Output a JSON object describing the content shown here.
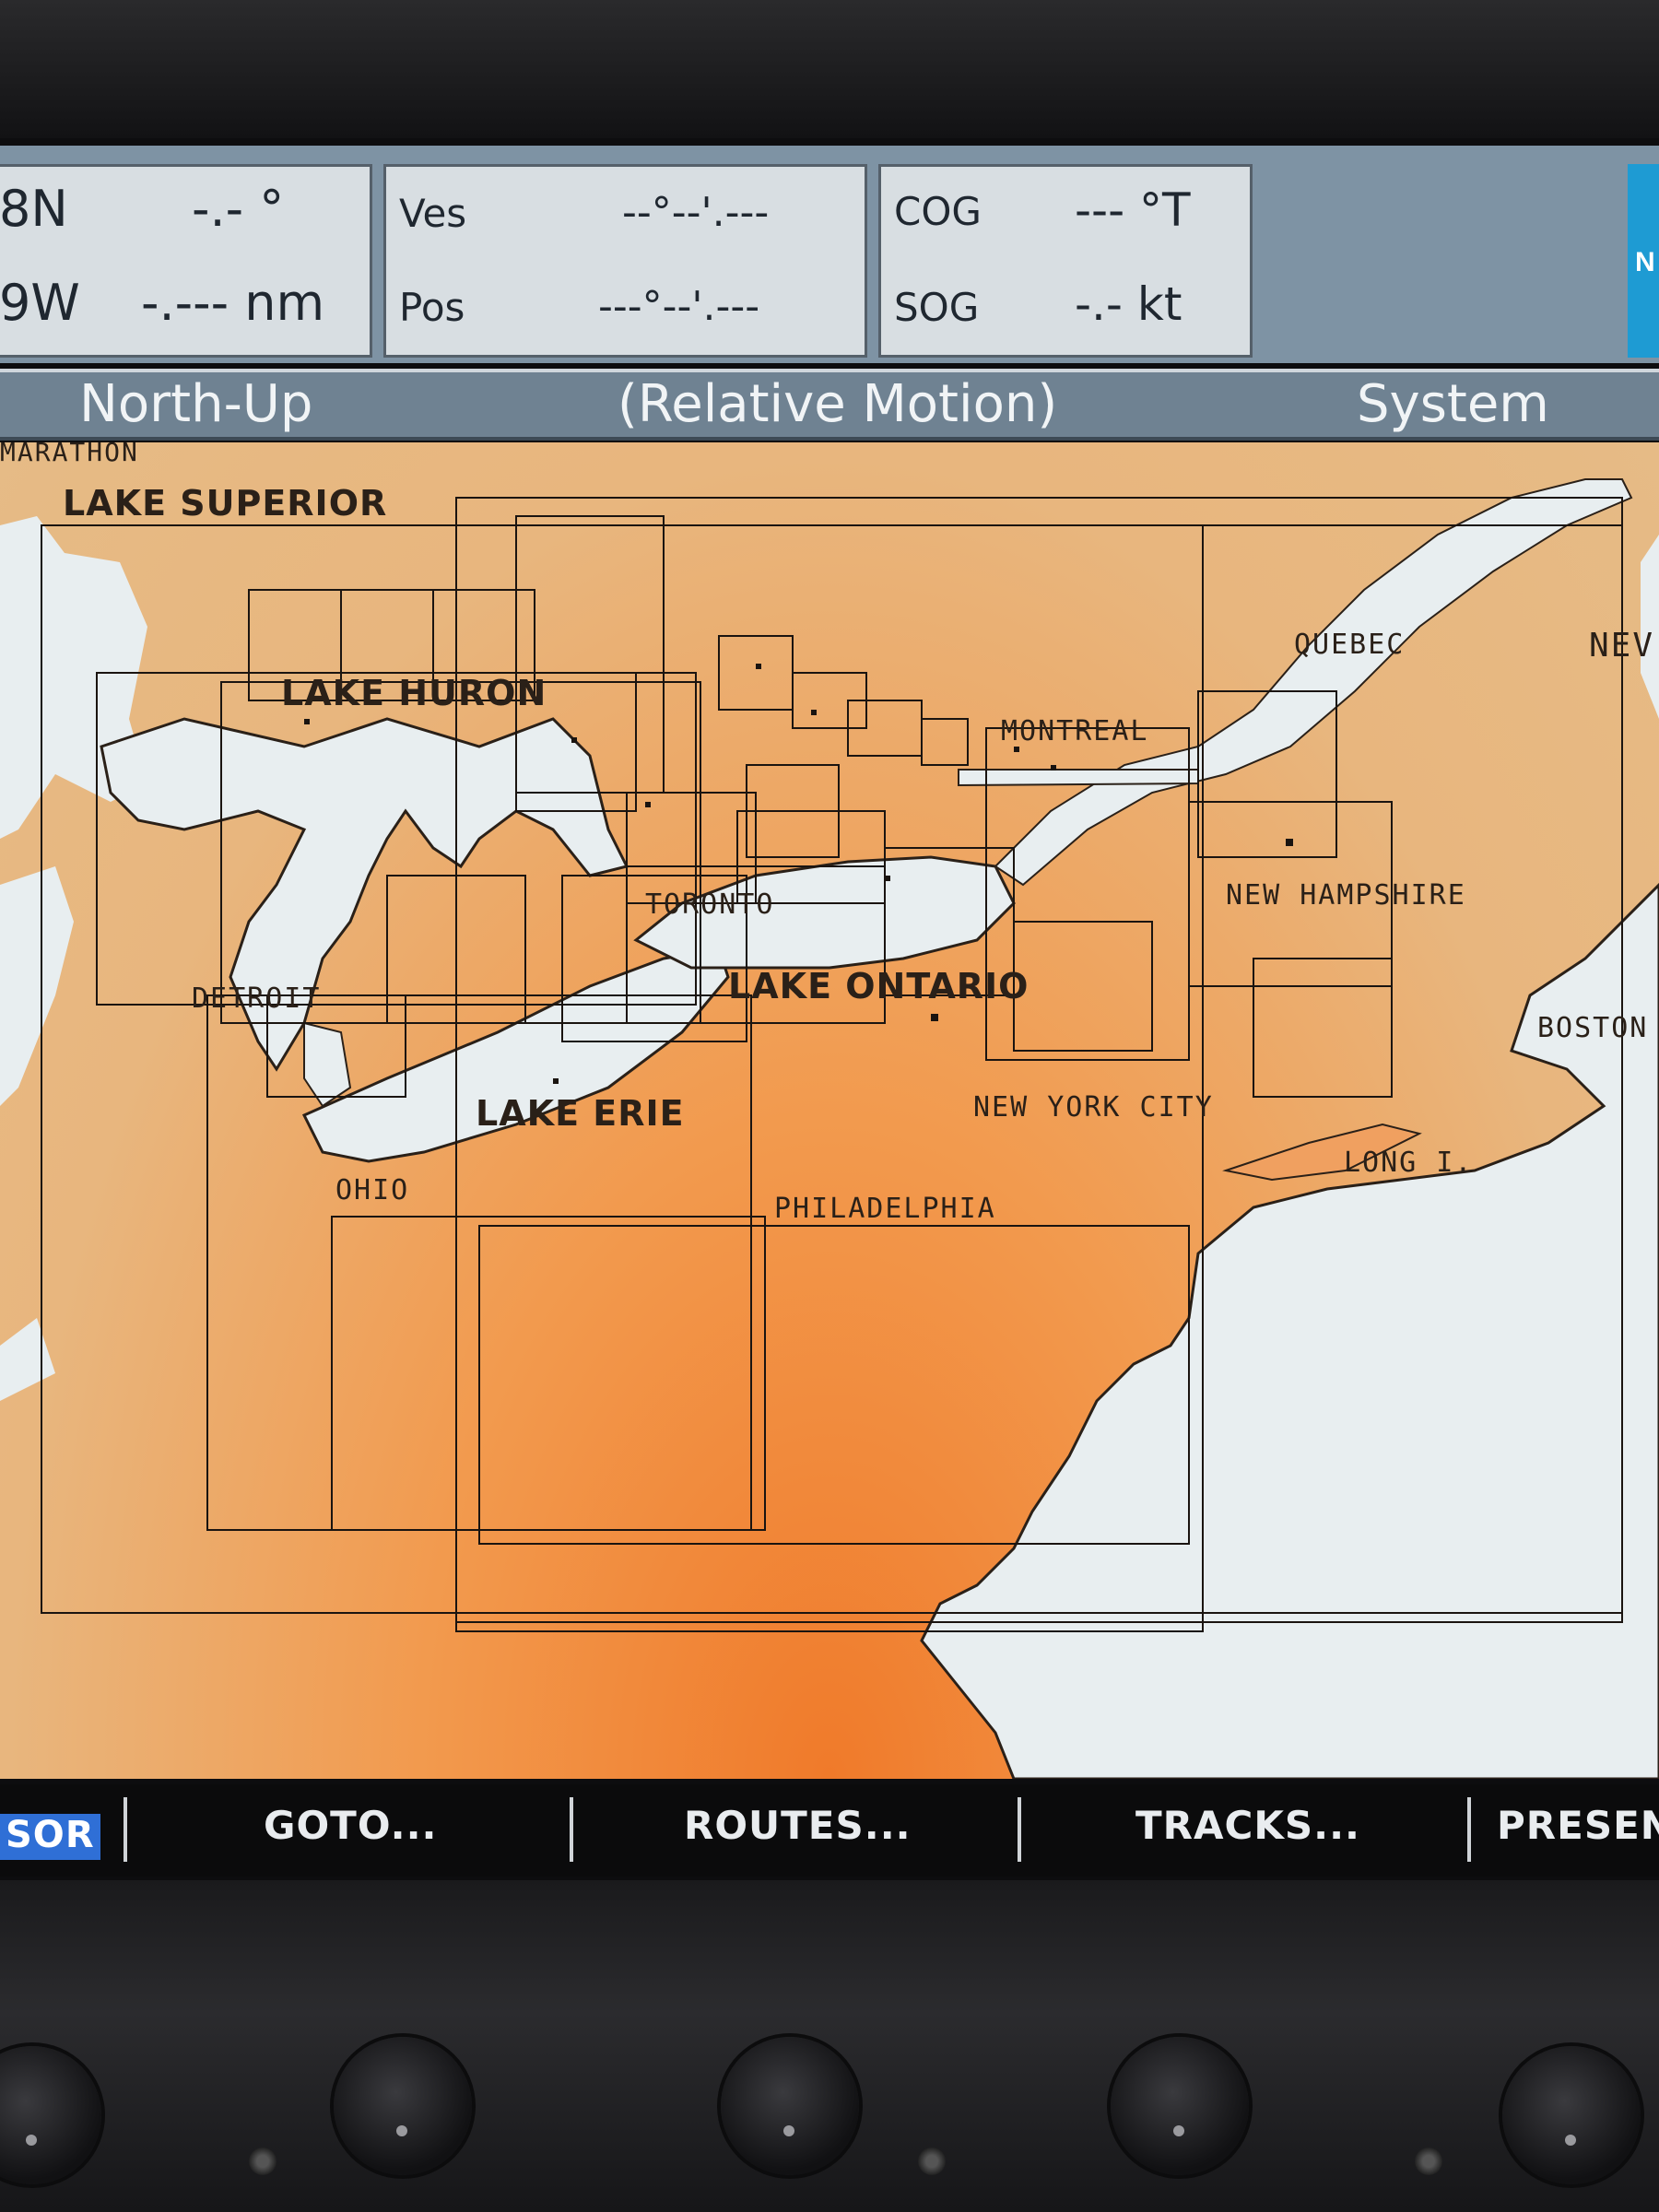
{
  "data_bar": {
    "cursor": {
      "lat": "8N",
      "lon": "9W",
      "bearing": "-.- °",
      "range": "-.--- nm"
    },
    "vessel": {
      "label_line1": "Ves",
      "label_line2": "Pos",
      "lat": "--°--'.---",
      "lon": "---°--'.---"
    },
    "motion": {
      "cog_label": "COG",
      "cog_value": "--- °T",
      "sog_label": "SOG",
      "sog_value": "-.- kt"
    },
    "logo_text": "N"
  },
  "mode_bar": {
    "orientation": "North-Up",
    "motion_mode": "(Relative Motion)",
    "source": "System"
  },
  "chart": {
    "place_labels": {
      "marathon": "MARATHON",
      "lake_superior": "LAKE SUPERIOR",
      "lake_huron": "LAKE HURON",
      "quebec": "QUEBEC",
      "new_edge": "NEV",
      "montreal": "MONTREAL",
      "toronto": "TORONTO",
      "new_hampshire": "NEW HAMPSHIRE",
      "lake_ontario": "LAKE ONTARIO",
      "detroit": "DETROIT",
      "boston": "BOSTON",
      "lake_erie": "LAKE ERIE",
      "new_york_city": "NEW YORK CITY",
      "long_island": "LONG I.",
      "ohio": "OHIO",
      "philadelphia": "PHILADELPHIA"
    },
    "colors": {
      "land": "#f0a060",
      "water": "#e8eef0",
      "outline": "#1a1410"
    }
  },
  "soft_keys": {
    "cursor": "SOR",
    "goto": "GOTO...",
    "routes": "ROUTES...",
    "tracks": "TRACKS...",
    "present": "PRESEN"
  }
}
